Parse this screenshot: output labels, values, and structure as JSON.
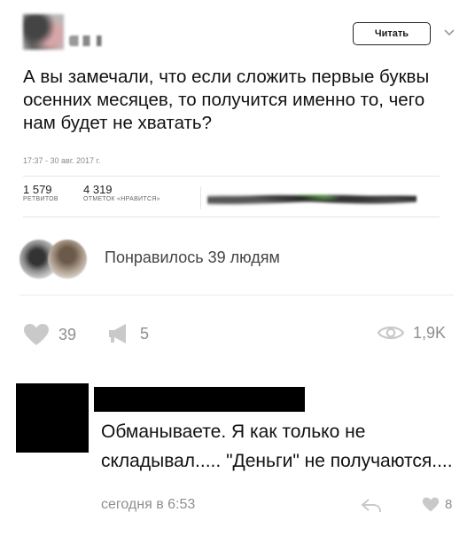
{
  "tweet": {
    "follow_label": "Читать",
    "text": "А вы замечали, что если сложить первые буквы осенних месяцев, то получится именно то, чего нам будет не хватать?",
    "timestamp": "17:37 - 30 авг. 2017 г.",
    "retweets": {
      "count": "1 579",
      "label": "РЕТВИТОВ"
    },
    "likes": {
      "count": "4 319",
      "label": "ОТМЕТОК «НРАВИТСЯ»"
    }
  },
  "post": {
    "liked_by_text": "Понравилось 39 людям",
    "like_count": "39",
    "repost_count": "5",
    "views_count": "1,9K"
  },
  "comment": {
    "text": "Обманываете. Я как только не складывал..... \"Деньги\" не получаются....",
    "time": "сегодня в 6:53",
    "likes": "8"
  }
}
